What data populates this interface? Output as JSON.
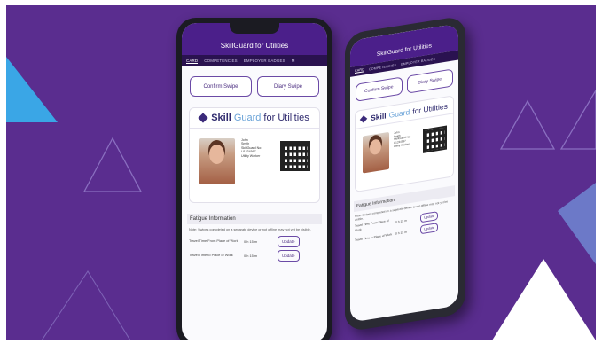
{
  "app": {
    "title": "SkillGuard for Utilities",
    "tabs": [
      "CARD",
      "COMPETENCIES",
      "EMPLOYER BADGES",
      "M"
    ]
  },
  "actions": {
    "confirm_label": "Confirm Swipe",
    "diary_label": "Diary Swipe"
  },
  "brand": {
    "part1": "Skill",
    "part2": "Guard",
    "part3": " for Utilities"
  },
  "card": {
    "first_name": "John",
    "last_name": "Smith",
    "line1": "SkillGuard No:",
    "line2": "U1234567",
    "line3": "Utility Worker"
  },
  "fatigue": {
    "title": "Fatigue Information",
    "note": "Note: Swipes completed on a separate device or not offline may not yet be visible.",
    "rows": [
      {
        "label": "Travel Time From Place of Work",
        "value": "0 h 15 m",
        "button": "Update"
      },
      {
        "label": "Travel Time to Place of Work",
        "value": "0 h 15 m",
        "button": "Update"
      }
    ]
  },
  "colors": {
    "background": "#5a2d8f",
    "header": "#4b1f8a",
    "tab_bar": "#2a1250",
    "accent": "#6b4aa6"
  }
}
